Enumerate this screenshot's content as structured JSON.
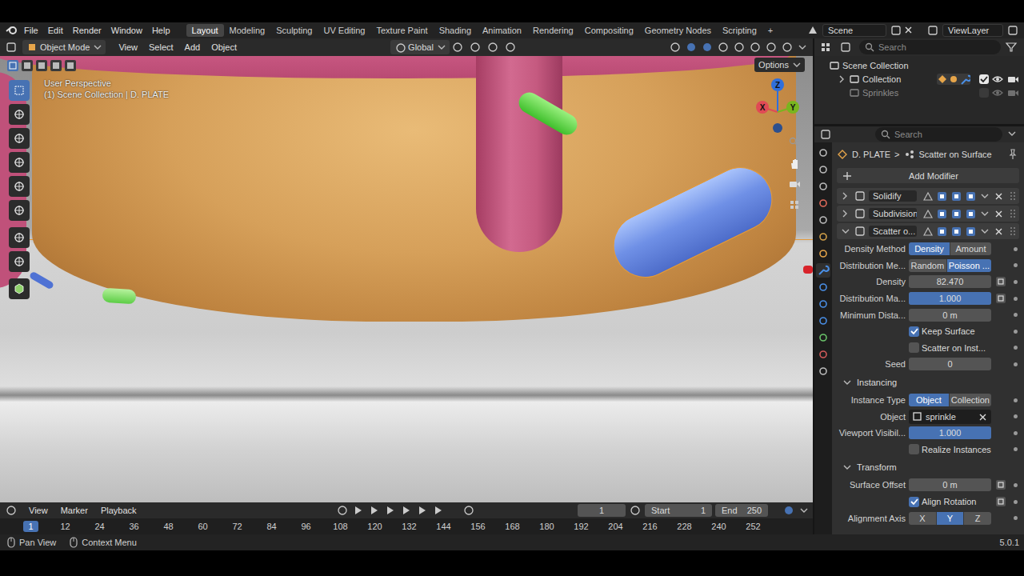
{
  "topbar": {
    "menus": [
      "File",
      "Edit",
      "Render",
      "Window",
      "Help"
    ],
    "workspaces": [
      {
        "label": "Layout",
        "selected": true
      },
      {
        "label": "Modeling",
        "selected": false
      },
      {
        "label": "Sculpting",
        "selected": false
      },
      {
        "label": "UV Editing",
        "selected": false
      },
      {
        "label": "Texture Paint",
        "selected": false
      },
      {
        "label": "Shading",
        "selected": false
      },
      {
        "label": "Animation",
        "selected": false
      },
      {
        "label": "Rendering",
        "selected": false
      },
      {
        "label": "Compositing",
        "selected": false
      },
      {
        "label": "Geometry Nodes",
        "selected": false
      },
      {
        "label": "Scripting",
        "selected": false
      }
    ],
    "add": "+",
    "scene": "Scene",
    "view_layer": "ViewLayer"
  },
  "viewport": {
    "mode": "Object Mode",
    "menus": [
      "View",
      "Select",
      "Add",
      "Object"
    ],
    "orientation": "Global",
    "options": "Options",
    "overlay": [
      "User Perspective",
      "(1) Scene Collection | D. PLATE"
    ],
    "axes": [
      {
        "label": "Z",
        "color": "#2f6fdc"
      },
      {
        "label": "X",
        "color": "#e04a55"
      },
      {
        "label": "Y",
        "color": "#79b51f"
      }
    ]
  },
  "timeline": {
    "menus": [
      "View",
      "Marker",
      "Playback"
    ],
    "frame": "1",
    "start_label": "Start",
    "start": "1",
    "end_label": "End",
    "end": "250",
    "ticks": [
      {
        "label": "1",
        "selected": true
      },
      {
        "label": "12",
        "selected": false
      },
      {
        "label": "24",
        "selected": false
      },
      {
        "label": "36",
        "selected": false
      },
      {
        "label": "48",
        "selected": false
      },
      {
        "label": "60",
        "selected": false
      },
      {
        "label": "72",
        "selected": false
      },
      {
        "label": "84",
        "selected": false
      },
      {
        "label": "96",
        "selected": false
      },
      {
        "label": "108",
        "selected": false
      },
      {
        "label": "120",
        "selected": false
      },
      {
        "label": "132",
        "selected": false
      },
      {
        "label": "144",
        "selected": false
      },
      {
        "label": "156",
        "selected": false
      },
      {
        "label": "168",
        "selected": false
      },
      {
        "label": "180",
        "selected": false
      },
      {
        "label": "192",
        "selected": false
      },
      {
        "label": "204",
        "selected": false
      },
      {
        "label": "216",
        "selected": false
      },
      {
        "label": "228",
        "selected": false
      },
      {
        "label": "240",
        "selected": false
      },
      {
        "label": "252",
        "selected": false
      }
    ]
  },
  "status_bar": {
    "items": [
      "Pan View",
      "Context Menu"
    ],
    "version": "5.0.1"
  },
  "outliner": {
    "search_placeholder": "Search",
    "items": [
      {
        "label": "Scene Collection",
        "depth": 0
      },
      {
        "label": "Collection",
        "depth": 1,
        "expanded": false,
        "checked": true,
        "disabled": false
      },
      {
        "label": "Sprinkles",
        "depth": 1,
        "checked": false,
        "disabled": true
      }
    ]
  },
  "properties": {
    "search_placeholder": "Search",
    "breadcrumb": [
      "D. PLATE",
      ">",
      "Scatter on Surface"
    ],
    "add_modifier": "Add Modifier",
    "modifiers": [
      {
        "name": "Solidify",
        "expanded": false
      },
      {
        "name": "Subdivision",
        "expanded": false
      },
      {
        "name": "Scatter o...",
        "expanded": true
      }
    ],
    "rows": [
      {
        "kind": "toggle",
        "label": "Density Method",
        "options": [
          {
            "label": "Density",
            "selected": true
          },
          {
            "label": "Amount",
            "selected": false
          }
        ]
      },
      {
        "kind": "toggle",
        "label": "Distribution Me...",
        "options": [
          {
            "label": "Random",
            "selected": false
          },
          {
            "label": "Poisson ...",
            "selected": true
          }
        ]
      },
      {
        "kind": "number",
        "label": "Density",
        "value": "82.470",
        "input_socket": true
      },
      {
        "kind": "slider",
        "label": "Distribution Ma...",
        "value": "1.000",
        "level": 1,
        "input_socket": true
      },
      {
        "kind": "number",
        "label": "Minimum Dista...",
        "value": "0 m",
        "input_socket": false
      },
      {
        "kind": "checkbox",
        "label": "Keep Surface",
        "checked": true,
        "input_socket": false
      },
      {
        "kind": "checkbox",
        "label": "Scatter on Inst...",
        "checked": false,
        "input_socket": false
      },
      {
        "kind": "number",
        "label": "Seed",
        "value": "0",
        "input_socket": false
      },
      {
        "kind": "section",
        "label": "Instancing",
        "expanded": true
      },
      {
        "kind": "toggle",
        "label": "Instance Type",
        "options": [
          {
            "label": "Object",
            "selected": true
          },
          {
            "label": "Collection",
            "selected": false
          }
        ]
      },
      {
        "kind": "object",
        "label": "Object",
        "value": "sprinkle"
      },
      {
        "kind": "slider",
        "label": "Viewport Visibil...",
        "value": "1.000",
        "level": 1,
        "input_socket": false
      },
      {
        "kind": "checkbox",
        "label": "Realize Instances",
        "checked": false,
        "input_socket": false
      },
      {
        "kind": "section",
        "label": "Transform",
        "expanded": true
      },
      {
        "kind": "number",
        "label": "Surface Offset",
        "value": "0 m",
        "input_socket": true
      },
      {
        "kind": "checkbox",
        "label": "Align Rotation",
        "checked": true,
        "input_socket": true
      },
      {
        "kind": "toggle",
        "label": "Alignment Axis",
        "options": [
          {
            "label": "X",
            "selected": false
          },
          {
            "label": "Y",
            "selected": true
          },
          {
            "label": "Z",
            "selected": false
          }
        ]
      }
    ]
  }
}
